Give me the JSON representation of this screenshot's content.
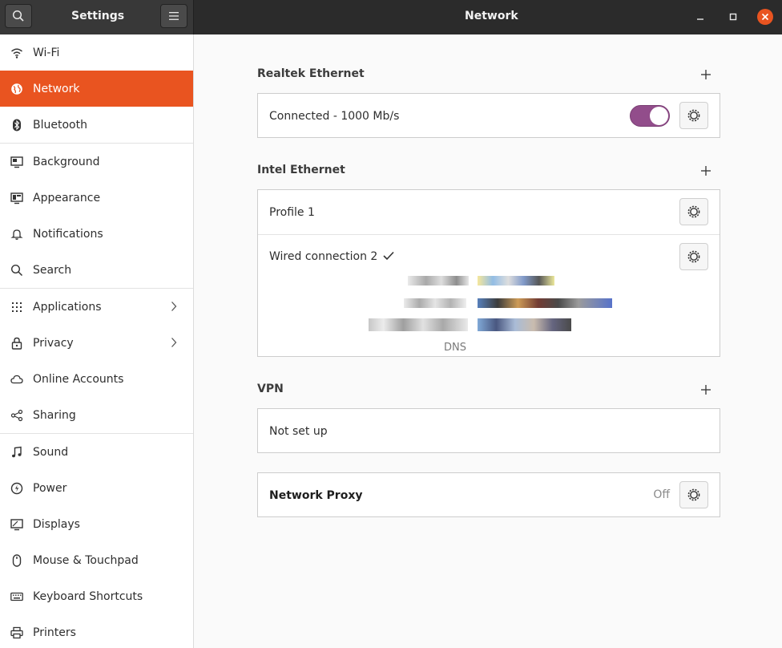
{
  "header": {
    "sidebar_title": "Settings",
    "title": "Network",
    "search_icon": "search-icon",
    "menu_icon": "hamburger-icon"
  },
  "sidebar": {
    "items": [
      {
        "label": "Wi-Fi",
        "icon": "wifi-icon"
      },
      {
        "label": "Network",
        "icon": "globe-icon",
        "active": true
      },
      {
        "label": "Bluetooth",
        "icon": "bluetooth-icon"
      },
      {
        "label": "Background",
        "icon": "background-icon"
      },
      {
        "label": "Appearance",
        "icon": "appearance-icon"
      },
      {
        "label": "Notifications",
        "icon": "bell-icon"
      },
      {
        "label": "Search",
        "icon": "search-icon"
      },
      {
        "label": "Applications",
        "icon": "grid-icon",
        "chevron": true
      },
      {
        "label": "Privacy",
        "icon": "lock-icon",
        "chevron": true
      },
      {
        "label": "Online Accounts",
        "icon": "cloud-icon"
      },
      {
        "label": "Sharing",
        "icon": "share-icon"
      },
      {
        "label": "Sound",
        "icon": "music-note-icon"
      },
      {
        "label": "Power",
        "icon": "power-icon"
      },
      {
        "label": "Displays",
        "icon": "display-icon"
      },
      {
        "label": "Mouse & Touchpad",
        "icon": "mouse-icon"
      },
      {
        "label": "Keyboard Shortcuts",
        "icon": "keyboard-icon"
      },
      {
        "label": "Printers",
        "icon": "printer-icon"
      }
    ]
  },
  "sections": {
    "realtek": {
      "title": "Realtek Ethernet",
      "status": "Connected - 1000 Mb/s",
      "toggle_on": true
    },
    "intel": {
      "title": "Intel Ethernet",
      "profile_label": "Profile 1",
      "wired_label": "Wired connection 2",
      "dns_label": "DNS"
    },
    "vpn": {
      "title": "VPN",
      "status": "Not set up"
    },
    "proxy": {
      "label": "Network Proxy",
      "status": "Off"
    }
  },
  "colors": {
    "accent": "#e95420",
    "toggle": "#924d8b",
    "header_bg": "#2b2b2b",
    "close_button": "#e95420"
  }
}
